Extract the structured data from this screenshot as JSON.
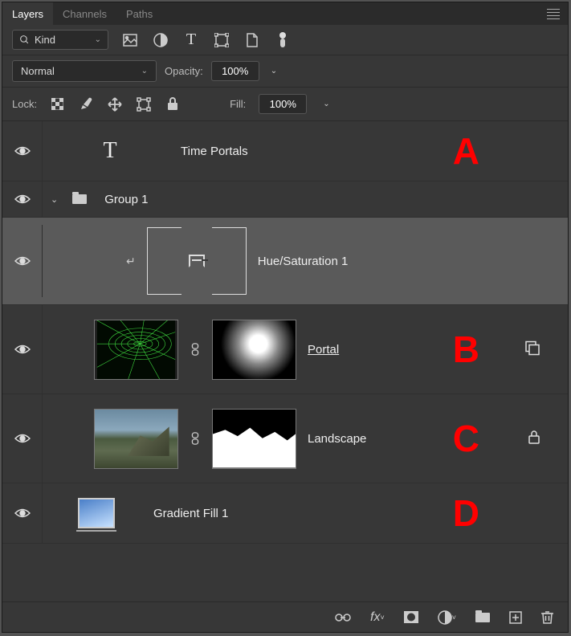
{
  "tabs": {
    "layers": "Layers",
    "channels": "Channels",
    "paths": "Paths"
  },
  "filter": {
    "kind_label": "Kind"
  },
  "blend": {
    "mode": "Normal",
    "opacity_label": "Opacity:",
    "opacity_value": "100%"
  },
  "lock": {
    "label": "Lock:",
    "fill_label": "Fill:",
    "fill_value": "100%"
  },
  "layers": {
    "text_layer": {
      "name": "Time Portals",
      "annot": "A"
    },
    "group": {
      "name": "Group 1"
    },
    "adj": {
      "name": "Hue/Saturation 1"
    },
    "portal": {
      "name": "Portal ",
      "annot": "B"
    },
    "landscape": {
      "name": "Landscape",
      "annot": "C"
    },
    "gradient": {
      "name": "Gradient Fill 1",
      "annot": "D"
    }
  }
}
